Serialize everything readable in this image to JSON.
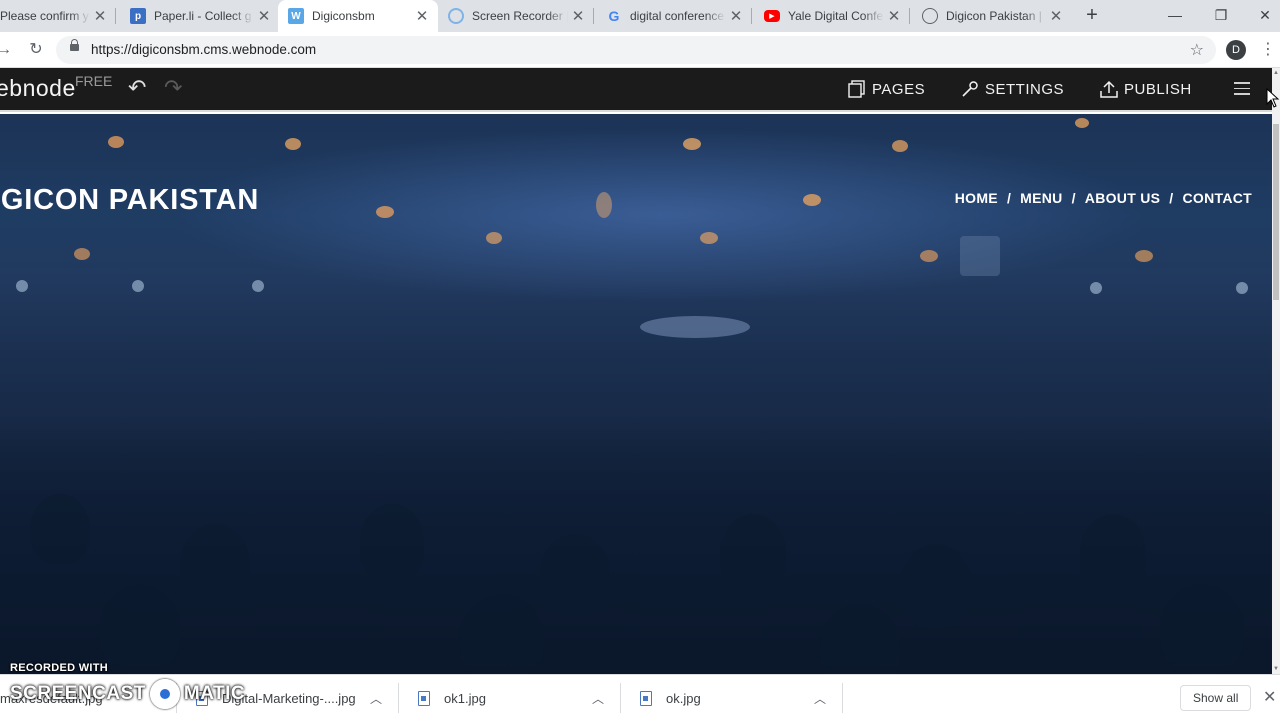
{
  "browser": {
    "tabs": [
      {
        "title": "Please confirm your",
        "favicon": "generic-page-icon",
        "active": false
      },
      {
        "title": "Paper.li - Collect g",
        "favicon": "paperli-icon",
        "active": false
      },
      {
        "title": "Digiconsbm",
        "favicon": "webnode-icon",
        "active": true
      },
      {
        "title": "Screen Recorder |",
        "favicon": "screencast-icon",
        "active": false
      },
      {
        "title": "digital conference",
        "favicon": "google-icon",
        "active": false
      },
      {
        "title": "Yale Digital Confer",
        "favicon": "youtube-icon",
        "active": false
      },
      {
        "title": "Digicon Pakistan |",
        "favicon": "globe-icon",
        "active": false
      }
    ],
    "new_tab_label": "+",
    "url": "https://digiconsbm.cms.webnode.com",
    "profile_initial": "D"
  },
  "editor": {
    "logo_text": "ebnode",
    "plan_label": "FREE",
    "pages_label": "PAGES",
    "settings_label": "SETTINGS",
    "publish_label": "PUBLISH"
  },
  "site": {
    "title": "IGICON PAKISTAN",
    "nav": [
      {
        "label": "HOME"
      },
      {
        "label": "MENU"
      },
      {
        "label": "ABOUT US"
      },
      {
        "label": "CONTACT"
      }
    ],
    "nav_separator": "/"
  },
  "downloads": {
    "items": [
      {
        "name": "maxresdefault.jpg"
      },
      {
        "name": "Digital-Marketing-....jpg"
      },
      {
        "name": "ok1.jpg"
      },
      {
        "name": "ok.jpg"
      }
    ],
    "show_all_label": "Show all"
  },
  "watermark": {
    "line1": "RECORDED WITH",
    "line2a": "SCREENCAST",
    "line2b": "MATIC"
  },
  "colors": {
    "editor_bar": "#1b1b1b",
    "hero_dark": "#14253f",
    "accent_blue": "#2b6fd6"
  }
}
